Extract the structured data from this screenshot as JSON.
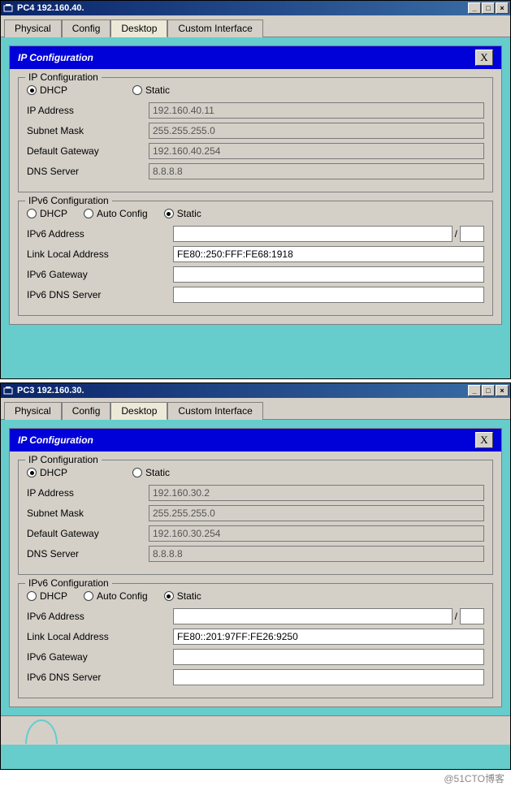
{
  "window1": {
    "title": "PC4 192.160.40.",
    "tabs": [
      "Physical",
      "Config",
      "Desktop",
      "Custom Interface"
    ],
    "activeTab": 2,
    "panel": {
      "title": "IP Configuration",
      "close": "X",
      "ipconfig": {
        "legend": "IP Configuration",
        "mode": "dhcp",
        "dhcpLabel": "DHCP",
        "staticLabel": "Static",
        "ipLabel": "IP Address",
        "ip": "192.160.40.11",
        "maskLabel": "Subnet Mask",
        "mask": "255.255.255.0",
        "gwLabel": "Default Gateway",
        "gw": "192.160.40.254",
        "dnsLabel": "DNS Server",
        "dns": "8.8.8.8"
      },
      "ipv6": {
        "legend": "IPv6 Configuration",
        "mode": "static",
        "dhcpLabel": "DHCP",
        "autoLabel": "Auto Config",
        "staticLabel": "Static",
        "addrLabel": "IPv6 Address",
        "addr": "",
        "prefix": "",
        "llLabel": "Link Local Address",
        "ll": "FE80::250:FFF:FE68:1918",
        "gwLabel": "IPv6 Gateway",
        "gw": "",
        "dnsLabel": "IPv6 DNS Server",
        "dns": ""
      }
    }
  },
  "window2": {
    "title": "PC3 192.160.30.",
    "tabs": [
      "Physical",
      "Config",
      "Desktop",
      "Custom Interface"
    ],
    "activeTab": 2,
    "panel": {
      "title": "IP Configuration",
      "close": "X",
      "ipconfig": {
        "legend": "IP Configuration",
        "mode": "dhcp",
        "dhcpLabel": "DHCP",
        "staticLabel": "Static",
        "ipLabel": "IP Address",
        "ip": "192.160.30.2",
        "maskLabel": "Subnet Mask",
        "mask": "255.255.255.0",
        "gwLabel": "Default Gateway",
        "gw": "192.160.30.254",
        "dnsLabel": "DNS Server",
        "dns": "8.8.8.8"
      },
      "ipv6": {
        "legend": "IPv6 Configuration",
        "mode": "static",
        "dhcpLabel": "DHCP",
        "autoLabel": "Auto Config",
        "staticLabel": "Static",
        "addrLabel": "IPv6 Address",
        "addr": "",
        "prefix": "",
        "llLabel": "Link Local Address",
        "ll": "FE80::201:97FF:FE26:9250",
        "gwLabel": "IPv6 Gateway",
        "gw": "",
        "dnsLabel": "IPv6 DNS Server",
        "dns": ""
      }
    }
  },
  "watermark": "@51CTO博客",
  "glyphs": {
    "min": "_",
    "max": "□",
    "close": "×",
    "slash": "/"
  }
}
